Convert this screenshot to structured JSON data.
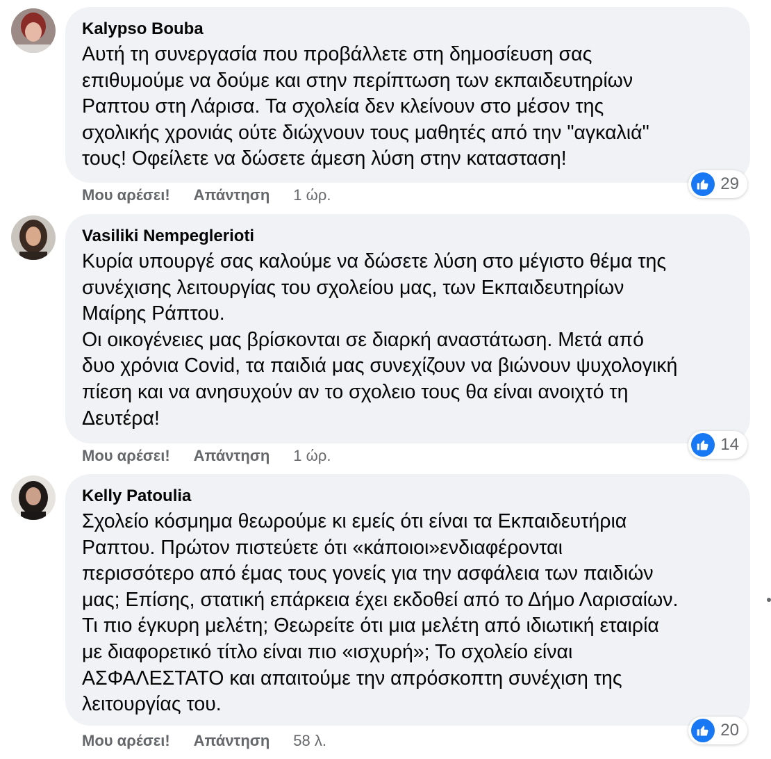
{
  "comments": [
    {
      "author": "Kalypso Bouba",
      "text": "Αυτή τη συνεργασία που προβάλλετε στη δημοσίευση σας\nεπιθυμούμε να δούμε και στην περίπτωση των εκπαιδευτηρίων\nΡαπτου στη Λάρισα. Τα σχολεία δεν κλείνουν στο μέσον της\nσχολικής χρονιάς ούτε διώχνουν τους μαθητές από την \"αγκαλιά\"\nτους! Οφείλετε να δώσετε άμεση λύση στην κατασταση!",
      "reactions": "29",
      "like_label": "Μου αρέσει!",
      "reply_label": "Απάντηση",
      "time": "1 ώρ."
    },
    {
      "author": "Vasiliki Nempeglerioti",
      "text": "Κυρία υπουργέ σας καλούμε να δώσετε λύση στο μέγιστο θέμα της\nσυνέχισης λειτουργίας του σχολείου μας, των Εκπαιδευτηρίων\nΜαίρης Ράπτου.\nΟι οικογένειες μας βρίσκονται σε διαρκή αναστάτωση. Μετά από\nδυο χρόνια Covid, τα παιδιά μας συνεχίζουν να βιώνουν ψυχολογική\nπίεση και να ανησυχούν αν το σχολειο τους θα είναι ανοιχτό τη\nΔευτέρα!",
      "reactions": "14",
      "like_label": "Μου αρέσει!",
      "reply_label": "Απάντηση",
      "time": "1 ώρ."
    },
    {
      "author": "Kelly Patoulia",
      "text": "Σχολείο κόσμημα θεωρούμε κι εμείς ότι είναι τα Εκπαιδευτήρια\nΡαπτου. Πρώτον πιστεύετε ότι «κάποιοι»ενδιαφέρονται\nπερισσότερο από έμας τους γονείς για την ασφάλεια των παιδιών\nμας; Επίσης, στατική επάρκεια έχει εκδοθεί από το Δήμο Λαρισαίων.\nΤι πιο έγκυρη μελέτη; Θεωρείτε ότι μια μελέτη από ιδιωτική εταιρία\nμε διαφορετικό τίτλο είναι πιο «ισχυρή»; Το σχολείο είναι\nΑΣΦΑΛΕΣΤΑΤΟ και απαιτούμε την απρόσκοπτη συνέχιση της\nλειτουργίας του.",
      "reactions": "20",
      "like_label": "Μου αρέσει!",
      "reply_label": "Απάντηση",
      "time": "58 λ."
    }
  ],
  "colors": {
    "bubble": "#f0f2f5",
    "like_blue": "#1877f2",
    "meta_gray": "#65676b"
  },
  "icons": {
    "like": "thumbs-up-icon"
  }
}
